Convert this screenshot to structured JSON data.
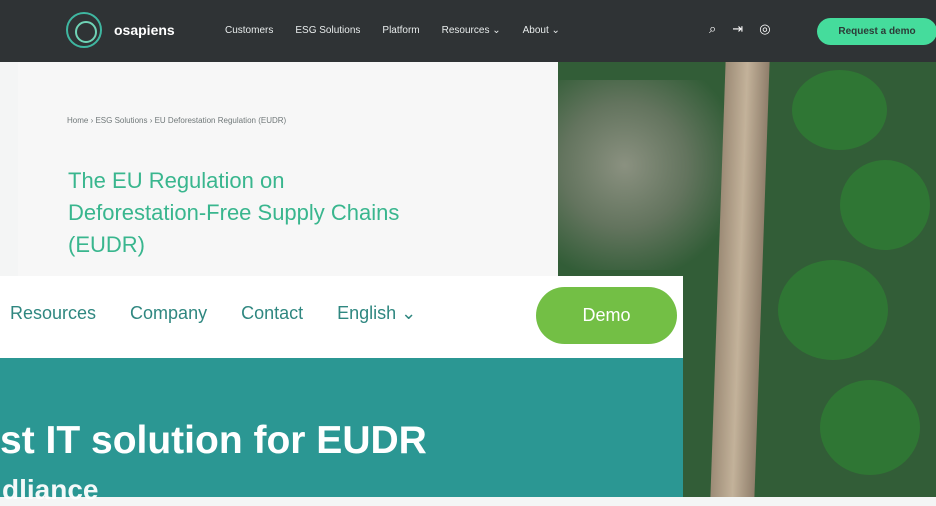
{
  "top_nav": {
    "brand": "osapiens",
    "links": [
      "Customers",
      "ESG Solutions",
      "Platform",
      "Resources ⌄",
      "About ⌄"
    ],
    "icons": [
      "search-icon",
      "login-icon",
      "globe-icon"
    ],
    "cta": "Request a demo"
  },
  "breadcrumb": "Home › ESG Solutions › EU Deforestation Regulation (EUDR)",
  "hero": {
    "title": "The EU Regulation on Deforestation-Free Supply Chains (EUDR)"
  },
  "overlay": {
    "links": [
      "Resources",
      "Company",
      "Contact",
      "English ⌄"
    ],
    "cta": "Demo",
    "headline": "st IT solution for EUDR",
    "subline": "dliance"
  }
}
